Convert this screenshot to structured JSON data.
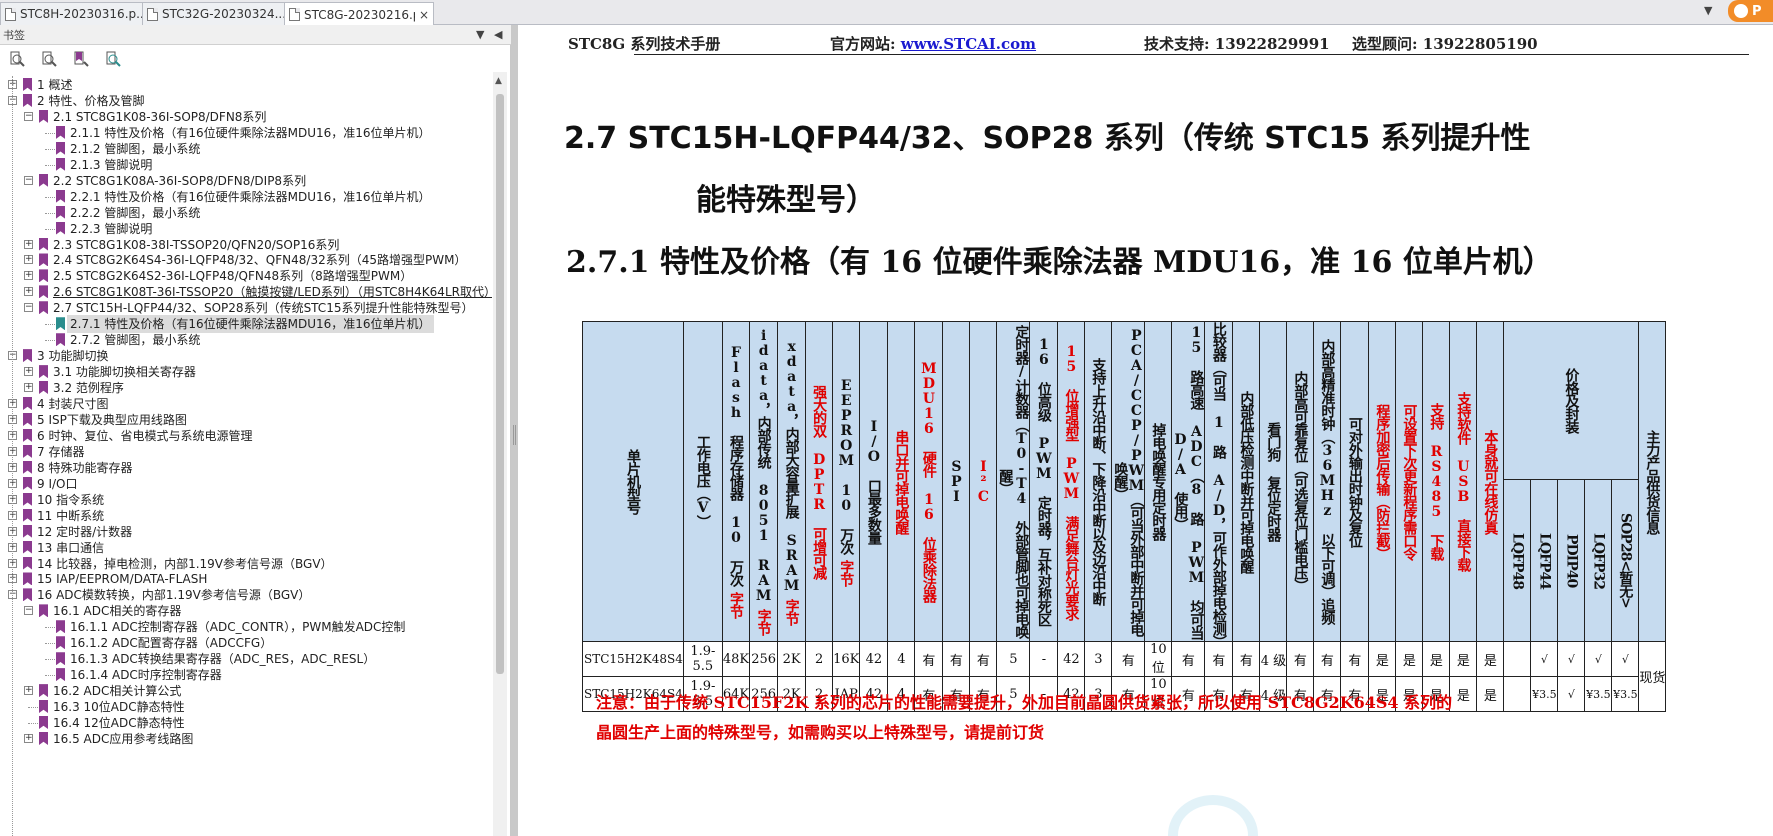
{
  "tabs": [
    {
      "label": "STC8H-20230316.p...",
      "active": false
    },
    {
      "label": "STC32G-20230324...",
      "active": false
    },
    {
      "label": "STC8G-20230216.pd...",
      "active": true
    }
  ],
  "tab_close_glyph": "×",
  "tab_dropdown_glyph": "▼",
  "corner_badge": "P",
  "bookmarks": {
    "panel_title": "书签",
    "header_controls": [
      "▼",
      "◀"
    ],
    "toolbar_icons": [
      "bookmark-expand-icon",
      "bookmark-collapse-icon",
      "bookmark-add-icon",
      "bookmark-find-icon"
    ],
    "items": [
      {
        "label": "1 概述",
        "level": 0,
        "toggle": "+"
      },
      {
        "label": "2 特性、价格及管脚",
        "level": 0,
        "toggle": "−"
      },
      {
        "label": "2.1 STC8G1K08-36I-SOP8/DFN8系列",
        "level": 1,
        "toggle": "−"
      },
      {
        "label": "2.1.1 特性及价格（有16位硬件乘除法器MDU16，准16位单片机）",
        "level": 2,
        "toggle": ""
      },
      {
        "label": "2.1.2 管脚图，最小系统",
        "level": 2,
        "toggle": ""
      },
      {
        "label": "2.1.3 管脚说明",
        "level": 2,
        "toggle": ""
      },
      {
        "label": "2.2 STC8G1K08A-36I-SOP8/DFN8/DIP8系列",
        "level": 1,
        "toggle": "−"
      },
      {
        "label": "2.2.1 特性及价格（有16位硬件乘除法器MDU16，准16位单片机）",
        "level": 2,
        "toggle": ""
      },
      {
        "label": "2.2.2 管脚图，最小系统",
        "level": 2,
        "toggle": ""
      },
      {
        "label": "2.2.3 管脚说明",
        "level": 2,
        "toggle": ""
      },
      {
        "label": "2.3 STC8G1K08-38I-TSSOP20/QFN20/SOP16系列",
        "level": 1,
        "toggle": "+"
      },
      {
        "label": "2.4 STC8G2K64S4-36I-LQFP48/32、QFN48/32系列（45路增强型PWM）",
        "level": 1,
        "toggle": "+"
      },
      {
        "label": "2.5 STC8G2K64S2-36I-LQFP48/QFN48系列（8路增强型PWM）",
        "level": 1,
        "toggle": "+"
      },
      {
        "label": "2.6 STC8G1K08T-36I-TSSOP20（触摸按键/LED系列）（用STC8H4K64LR取代）",
        "level": 1,
        "toggle": "+"
      },
      {
        "label": "2.7 STC15H-LQFP44/32、SOP28系列（传统STC15系列提升性能特殊型号）",
        "level": 1,
        "toggle": "−"
      },
      {
        "label": "2.7.1 特性及价格（有16位硬件乘除法器MDU16，准16位单片机）",
        "level": 2,
        "toggle": "",
        "selected": true
      },
      {
        "label": "2.7.2 管脚图，最小系统",
        "level": 2,
        "toggle": ""
      },
      {
        "label": "3 功能脚切换",
        "level": 0,
        "toggle": "−"
      },
      {
        "label": "3.1 功能脚切换相关寄存器",
        "level": 1,
        "toggle": "+"
      },
      {
        "label": "3.2 范例程序",
        "level": 1,
        "toggle": "+"
      },
      {
        "label": "4 封装尺寸图",
        "level": 0,
        "toggle": "+"
      },
      {
        "label": "5 ISP下载及典型应用线路图",
        "level": 0,
        "toggle": "+"
      },
      {
        "label": "6 时钟、复位、省电模式与系统电源管理",
        "level": 0,
        "toggle": "+"
      },
      {
        "label": "7 存储器",
        "level": 0,
        "toggle": "+"
      },
      {
        "label": "8 特殊功能寄存器",
        "level": 0,
        "toggle": "+"
      },
      {
        "label": "9 I/O口",
        "level": 0,
        "toggle": "+"
      },
      {
        "label": "10 指令系统",
        "level": 0,
        "toggle": "+"
      },
      {
        "label": "11 中断系统",
        "level": 0,
        "toggle": "+"
      },
      {
        "label": "12 定时器/计数器",
        "level": 0,
        "toggle": "+"
      },
      {
        "label": "13 串口通信",
        "level": 0,
        "toggle": "+"
      },
      {
        "label": "14 比较器，掉电检测，内部1.19V参考信号源（BGV）",
        "level": 0,
        "toggle": "+"
      },
      {
        "label": "15 IAP/EEPROM/DATA-FLASH",
        "level": 0,
        "toggle": "+"
      },
      {
        "label": "16 ADC模数转换，内部1.19V参考信号源（BGV）",
        "level": 0,
        "toggle": "−"
      },
      {
        "label": "16.1 ADC相关的寄存器",
        "level": 1,
        "toggle": "−"
      },
      {
        "label": "16.1.1 ADC控制寄存器（ADC_CONTR），PWM触发ADC控制",
        "level": 2,
        "toggle": ""
      },
      {
        "label": "16.1.2 ADC配置寄存器（ADCCFG）",
        "level": 2,
        "toggle": ""
      },
      {
        "label": "16.1.3 ADC转换结果寄存器（ADC_RES，ADC_RESL）",
        "level": 2,
        "toggle": ""
      },
      {
        "label": "16.1.4  ADC时序控制寄存器",
        "level": 2,
        "toggle": ""
      },
      {
        "label": "16.2 ADC相关计算公式",
        "level": 1,
        "toggle": "+"
      },
      {
        "label": "16.3 10位ADC静态特性",
        "level": 1,
        "toggle": ""
      },
      {
        "label": "16.4 12位ADC静态特性",
        "level": 1,
        "toggle": ""
      },
      {
        "label": "16.5 ADC应用参考线路图",
        "level": 1,
        "toggle": "+"
      }
    ]
  },
  "page": {
    "header": {
      "manual": "STC8G 系列技术手册",
      "site_label": "官方网站: ",
      "site_link": "www.STCAI.com",
      "support": "技术支持: 13922829991",
      "consult": "选型顾问: 13922805190"
    },
    "section_title_line1": "2.7   STC15H-LQFP44/32、SOP28 系列（传统 STC15 系列提升性",
    "section_title_line2": "能特殊型号）",
    "subsection_title": "2.7.1    特性及价格（有 16 位硬件乘除法器 MDU16，准 16 位单片机）",
    "table": {
      "headers": [
        {
          "text": "单片机型号",
          "red": false
        },
        {
          "text": "工作电压（V）",
          "red": false
        },
        {
          "text": "Flash 程序存储器 10 万次",
          "extra": "字节",
          "red": false
        },
        {
          "text": "idata，内部传统 8051 RAM",
          "extra": "字节",
          "red": false
        },
        {
          "text": "xdata，内部大容量扩展 SRAM",
          "extra": "字节",
          "red": false
        },
        {
          "text": "强大的双 DPTR 可增可减",
          "red": true
        },
        {
          "text": "EEPROM 10 万次",
          "extra": "字节",
          "red": false
        },
        {
          "text": "I/O 口最多数量",
          "red": false
        },
        {
          "text": "串口并可掉电唤醒",
          "red": true
        },
        {
          "text": "MDU16 硬件 16 位乘除法器",
          "red": true
        },
        {
          "text": "SPI",
          "red": false
        },
        {
          "text": "I²C",
          "red": true
        },
        {
          "text": "定时器/计数器（T0-T4 外部管脚也可掉电唤醒）",
          "red": false
        },
        {
          "text": "16 位高级 PWM 定时器，互补对称死区",
          "red": false
        },
        {
          "text": "15 位增强型 PWM 满足舞台灯光要求",
          "red": true
        },
        {
          "text": "支持上升沿中断、下降沿中断以及边沿中断",
          "red": false
        },
        {
          "text": "PCA/CCP/PWM（可当外部中断并可掉电唤醒）",
          "red": false
        },
        {
          "text": "掉电唤醒专用定时器",
          "red": false
        },
        {
          "text": "15 路高速 ADC（8 路 PWM 均可当 D/A 使用）",
          "red": false
        },
        {
          "text": "比较器（可当 1 路 A/D，可作外部掉电检测）",
          "red": false
        },
        {
          "text": "内部低压检测中断并可掉电唤醒",
          "red": false
        },
        {
          "text": "看门狗 复位定时器",
          "red": false
        },
        {
          "text": "内部高可靠复位（可选复位门槛电压）",
          "red": false
        },
        {
          "text": "内部高精准时钟（36MHz 以下可调）追频",
          "red": false
        },
        {
          "text": "可对外输出时钟及复位",
          "red": false
        },
        {
          "text": "程序加密后传输（防拦截）",
          "red": true
        },
        {
          "text": "可设置下次更新程序需口令",
          "red": true
        },
        {
          "text": "支持 RS485 下载",
          "red": true
        },
        {
          "text": "支持软件 USB 直接下载",
          "red": true
        },
        {
          "text": "本身就可在线仿真",
          "red": true
        }
      ],
      "price_group_label": "价格及封装",
      "package_headers": [
        "LQFP48",
        "LQFP44",
        "PDIP40",
        "LQFP32",
        "SOP28<暂无>"
      ],
      "supply_header": "主力产品供货信息",
      "rows": [
        {
          "cells": [
            "STC15H2K48S4",
            "1.9-5.5",
            "48K",
            "256",
            "2K",
            "2",
            "16K",
            "42",
            "4",
            "有",
            "有",
            "有",
            "5",
            "-",
            "42",
            "3",
            "有",
            "10位",
            "有",
            "有",
            "有",
            "4 级",
            "有",
            "有",
            "有",
            "是",
            "是",
            "是",
            "是",
            "是"
          ],
          "prices": [
            "",
            "√",
            "√",
            "√",
            "√"
          ]
        },
        {
          "cells": [
            "STC15H2K64S4",
            "1.9-5.5",
            "64K",
            "256",
            "2K",
            "2",
            "IAP",
            "42",
            "4",
            "有",
            "有",
            "有",
            "5",
            "-",
            "42",
            "3",
            "有",
            "10位",
            "有",
            "有",
            "有",
            "4 级",
            "有",
            "有",
            "有",
            "是",
            "是",
            "是",
            "是",
            "是"
          ],
          "prices": [
            "",
            "¥3.5",
            "√",
            "¥3.5",
            "¥3.5"
          ]
        }
      ],
      "supply_value": "现货"
    },
    "note_line1": "注意：由于传统 STC15F2K 系列的芯片的性能需要提升，外加目前晶圆供货紧张，所以使用 STC8G2K64S4 系列的",
    "note_line2": "晶圆生产上面的特殊型号，如需购买以上特殊型号，请提前订货"
  }
}
